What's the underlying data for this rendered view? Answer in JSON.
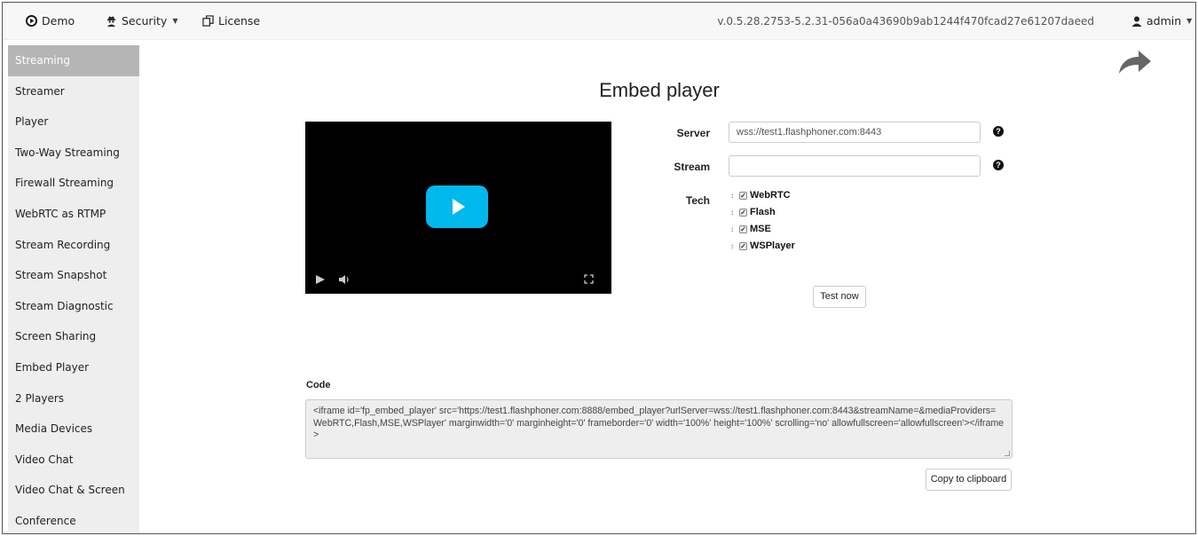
{
  "topnav": {
    "demo_label": "Demo",
    "security_label": "Security",
    "license_label": "License",
    "version": "v.0.5.28.2753-5.2.31-056a0a43690b9ab1244f470fcad27e61207daeed",
    "user_label": "admin"
  },
  "sidebar": {
    "items": [
      {
        "label": "Streaming"
      },
      {
        "label": "Streamer"
      },
      {
        "label": "Player"
      },
      {
        "label": "Two-Way Streaming"
      },
      {
        "label": "Firewall Streaming"
      },
      {
        "label": "WebRTC as RTMP"
      },
      {
        "label": "Stream Recording"
      },
      {
        "label": "Stream Snapshot"
      },
      {
        "label": "Stream Diagnostic"
      },
      {
        "label": "Screen Sharing"
      },
      {
        "label": "Embed Player"
      },
      {
        "label": "2 Players"
      },
      {
        "label": "Media Devices"
      },
      {
        "label": "Video Chat"
      },
      {
        "label": "Video Chat & Screen"
      },
      {
        "label": "Conference"
      }
    ],
    "active_index": 0
  },
  "main": {
    "title": "Embed player",
    "server_label": "Server",
    "server_value": "wss://test1.flashphoner.com:8443",
    "stream_label": "Stream",
    "stream_value": "",
    "tech_label": "Tech",
    "tech_options": [
      {
        "label": "WebRTC",
        "checked": true
      },
      {
        "label": "Flash",
        "checked": true
      },
      {
        "label": "MSE",
        "checked": true
      },
      {
        "label": "WSPlayer",
        "checked": true
      }
    ],
    "test_button": "Test now",
    "code_label": "Code",
    "code_text": "<iframe id='fp_embed_player' src='https://test1.flashphoner.com:8888/embed_player?urlServer=wss://test1.flashphoner.com:8443&streamName=&mediaProviders=WebRTC,Flash,MSE,WSPlayer' marginwidth='0' marginheight='0' frameborder='0' width='100%' height='100%' scrolling='no' allowfullscreen='allowfullscreen'></iframe>",
    "copy_button": "Copy to clipboard"
  },
  "colors": {
    "accent_play": "#00b8ec",
    "sidebar_bg": "#eeeeee",
    "sidebar_active": "#b5b5b5"
  }
}
